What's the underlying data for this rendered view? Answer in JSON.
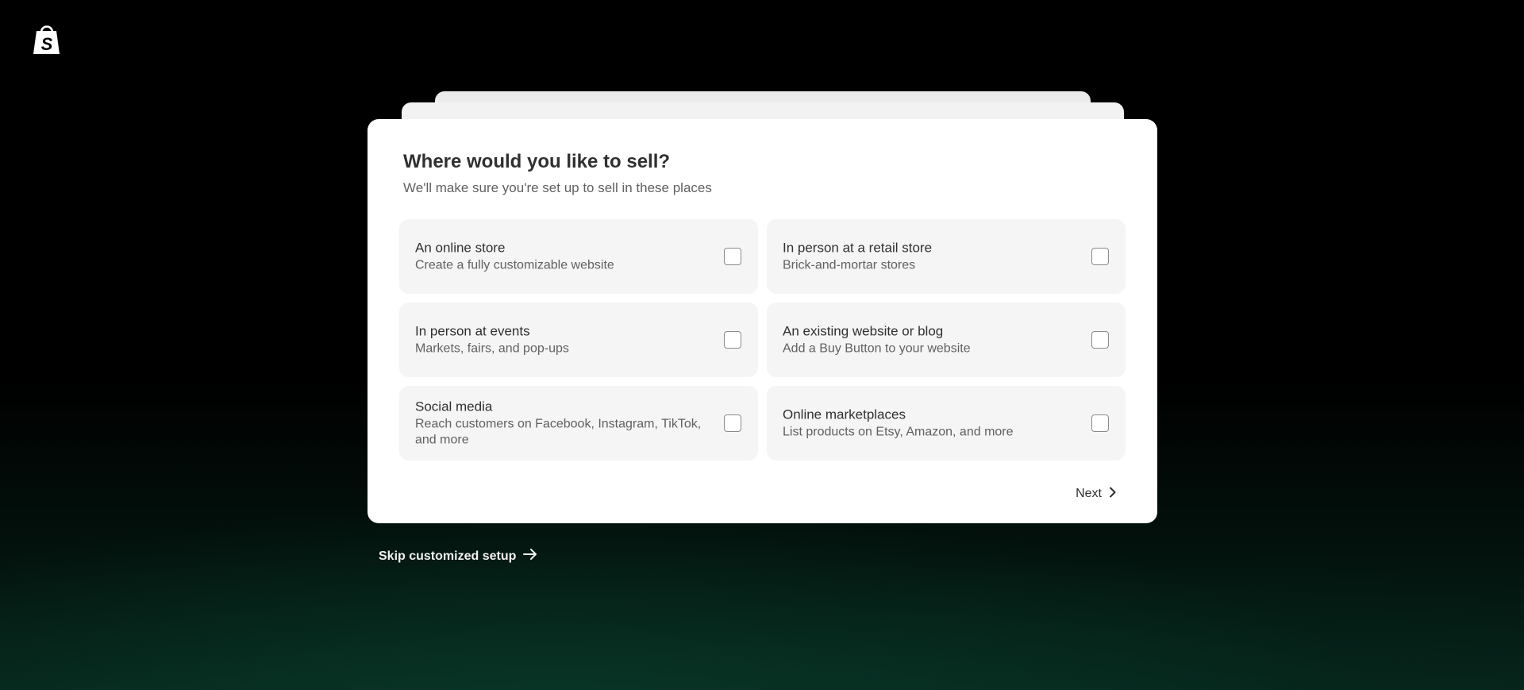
{
  "brand": {
    "logo_icon": "shopify-bag-icon"
  },
  "card": {
    "title": "Where would you like to sell?",
    "subtitle": "We'll make sure you're set up to sell in these places"
  },
  "options": [
    {
      "title": "An online store",
      "description": "Create a fully customizable website",
      "checked": false
    },
    {
      "title": "In person at a retail store",
      "description": "Brick-and-mortar stores",
      "checked": false
    },
    {
      "title": "In person at events",
      "description": "Markets, fairs, and pop-ups",
      "checked": false
    },
    {
      "title": "An existing website or blog",
      "description": "Add a Buy Button to your website",
      "checked": false
    },
    {
      "title": "Social media",
      "description": "Reach customers on Facebook, Instagram, TikTok, and more",
      "checked": false
    },
    {
      "title": "Online marketplaces",
      "description": "List products on Etsy, Amazon, and more",
      "checked": false
    }
  ],
  "actions": {
    "next_label": "Next",
    "skip_label": "Skip customized setup"
  }
}
